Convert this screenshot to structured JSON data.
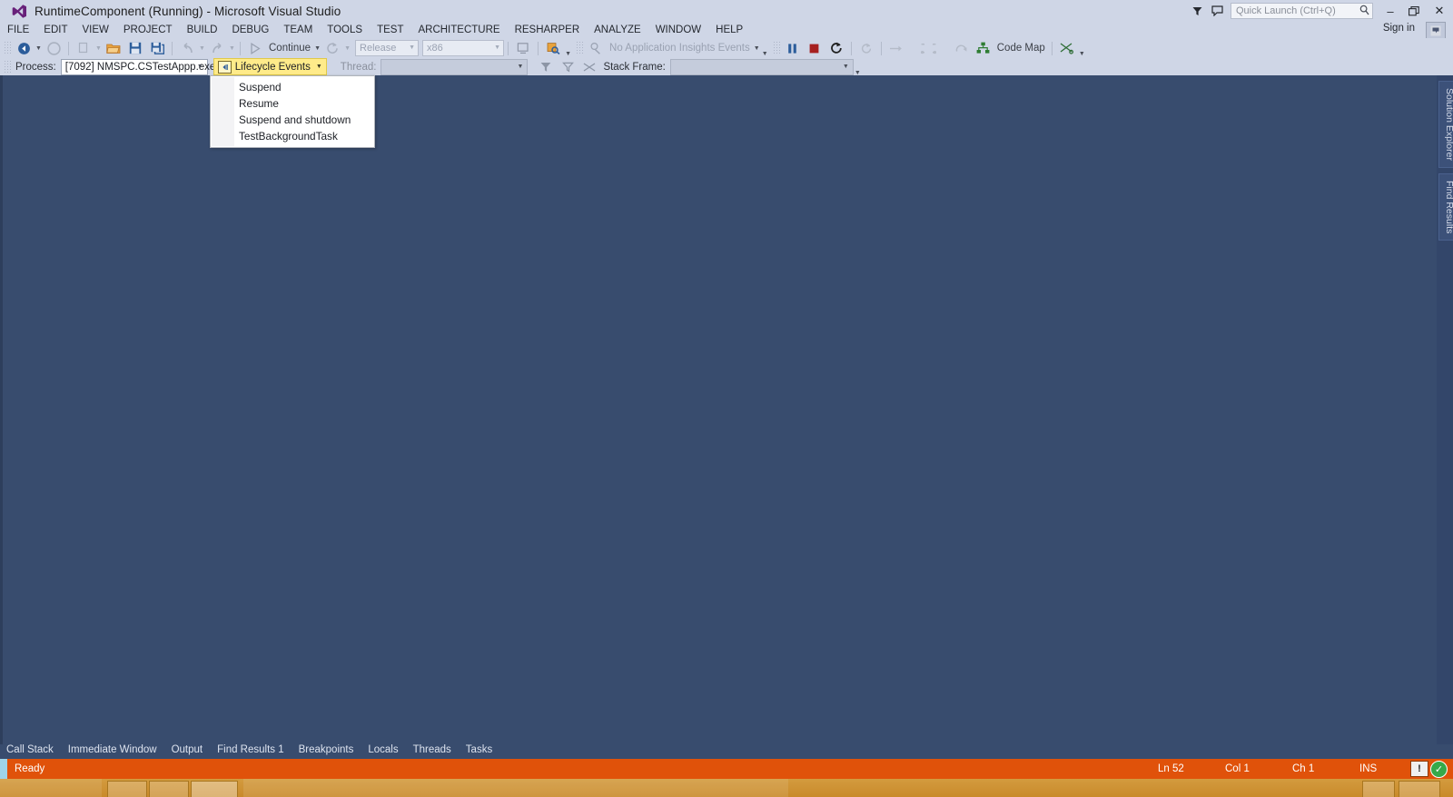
{
  "window": {
    "title": "RuntimeComponent (Running) - Microsoft Visual Studio",
    "logo_icon": "visual-studio-logo-icon",
    "minimize_label": "–",
    "maximize_label": "❐",
    "close_label": "✕",
    "sign_in_label": "Sign in",
    "feedback_icon": "feedback-smiley-icon",
    "notify_icon": "notifications-flag-icon",
    "comment_icon": "comment-icon"
  },
  "quick_launch": {
    "placeholder": "Quick Launch (Ctrl+Q)",
    "value": "",
    "search_icon": "magnifier-icon"
  },
  "menubar": {
    "items": [
      {
        "label": "FILE",
        "accel": "F"
      },
      {
        "label": "EDIT",
        "accel": "E"
      },
      {
        "label": "VIEW",
        "accel": "V"
      },
      {
        "label": "PROJECT",
        "accel": "P"
      },
      {
        "label": "BUILD",
        "accel": "B"
      },
      {
        "label": "DEBUG",
        "accel": "D"
      },
      {
        "label": "TEAM",
        "accel": "M"
      },
      {
        "label": "TOOLS",
        "accel": "T"
      },
      {
        "label": "TEST",
        "accel": "S"
      },
      {
        "label": "ARCHITECTURE",
        "accel": "C"
      },
      {
        "label": "RESHARPER",
        "accel": "R"
      },
      {
        "label": "ANALYZE",
        "accel": "N"
      },
      {
        "label": "WINDOW",
        "accel": "W"
      },
      {
        "label": "HELP",
        "accel": "H"
      }
    ]
  },
  "toolbar": {
    "navigate_back_icon": "navigate-backward-icon",
    "navigate_forward_icon": "navigate-forward-icon",
    "new_project_icon": "new-project-icon",
    "open_file_icon": "open-file-icon",
    "save_icon": "save-icon",
    "save_all_icon": "save-all-icon",
    "undo_icon": "undo-icon",
    "redo_icon": "redo-icon",
    "continue_icon": "continue-play-icon",
    "continue_label": "Continue",
    "restart_icon": "restart-icon",
    "configuration_value": "Release",
    "platform_value": "x86",
    "simulate_location_icon": "simulate-location-icon",
    "find_icon": "find-in-files-icon",
    "insights_icon": "application-insights-icon",
    "insights_label": "No Application Insights Events",
    "break_all_icon": "break-all-pause-icon",
    "stop_icon": "stop-debugging-icon",
    "restart_debug_icon": "restart-debugging-icon",
    "show_next_statement_icon": "show-next-statement-icon",
    "step_over_icon": "step-over-icon",
    "step_into_icon": "step-into-icon",
    "step_out_icon": "step-out-icon",
    "step_next_icon": "step-next-icon",
    "code_map_icon": "code-map-icon",
    "code_map_label": "Code Map",
    "ide_overflow_icon": "toolbar-overflow-icon"
  },
  "debug_location": {
    "process_label": "Process:",
    "process_value": "[7092] NMSPC.CSTestAppp.exe",
    "lifecycle_label": "Lifecycle Events",
    "lifecycle_icon": "lifecycle-events-icon",
    "thread_label": "Thread:",
    "thread_value": "",
    "flag_icon": "flag-threads-icon",
    "flag_only_icon": "show-flagged-threads-icon",
    "freeze_icon": "freeze-thread-icon",
    "stack_frame_label": "Stack Frame:",
    "stack_frame_value": ""
  },
  "lifecycle_menu": {
    "items": [
      {
        "label": "Suspend"
      },
      {
        "label": "Resume"
      },
      {
        "label": "Suspend and shutdown"
      },
      {
        "label": "TestBackgroundTask"
      }
    ]
  },
  "side_tabs": [
    {
      "label": "Solution Explorer"
    },
    {
      "label": "Find Results"
    }
  ],
  "bottom_tabs": [
    {
      "label": "Call Stack"
    },
    {
      "label": "Immediate Window"
    },
    {
      "label": "Output"
    },
    {
      "label": "Find Results 1"
    },
    {
      "label": "Breakpoints"
    },
    {
      "label": "Locals"
    },
    {
      "label": "Threads"
    },
    {
      "label": "Tasks"
    }
  ],
  "statusbar": {
    "status": "Ready",
    "line": "Ln 52",
    "column": "Col 1",
    "character": "Ch 1",
    "insert_mode": "INS",
    "warning_icon": "warning-notification-icon",
    "warning_glyph": "!",
    "ok_icon": "success-check-icon",
    "ok_glyph": "✓"
  },
  "colors": {
    "accent_orange": "#e0520a",
    "workspace_blue": "#384c6e",
    "chrome_blue": "#cfd6e6",
    "highlight_yellow": "#ffeb8a"
  }
}
